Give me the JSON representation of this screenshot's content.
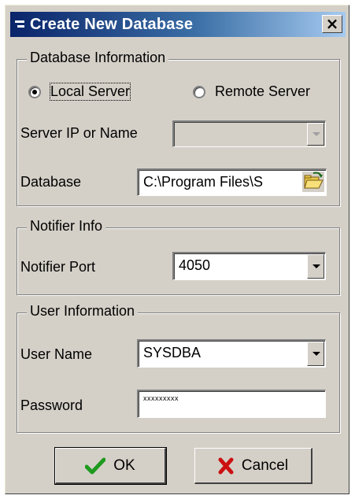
{
  "window": {
    "title": "Create New Database",
    "close_label": "×"
  },
  "database_info": {
    "legend": "Database Information",
    "local_server_label": "Local Server",
    "local_server_selected": true,
    "remote_server_label": "Remote Server",
    "remote_server_selected": false,
    "server_ip_label": "Server IP or Name",
    "server_ip_value": "",
    "server_ip_enabled": false,
    "database_label": "Database",
    "database_value": "C:\\Program Files\\S"
  },
  "notifier_info": {
    "legend": "Notifier Info",
    "port_label": "Notifier Port",
    "port_value": "4050"
  },
  "user_info": {
    "legend": "User Information",
    "username_label": "User Name",
    "username_value": "SYSDBA",
    "password_label": "Password",
    "password_value": "xxxxxxxxx"
  },
  "buttons": {
    "ok_label": "OK",
    "cancel_label": "Cancel"
  },
  "icons": {
    "title_icon": "window-menu-icon",
    "folder": "open-folder-icon",
    "ok": "checkmark-icon",
    "cancel": "x-mark-icon"
  },
  "colors": {
    "titlebar_start": "#0a246a",
    "titlebar_end": "#a6caf0",
    "face": "#d4d0c8",
    "ok_check": "#1e9a1e",
    "cancel_x": "#cc1010"
  }
}
